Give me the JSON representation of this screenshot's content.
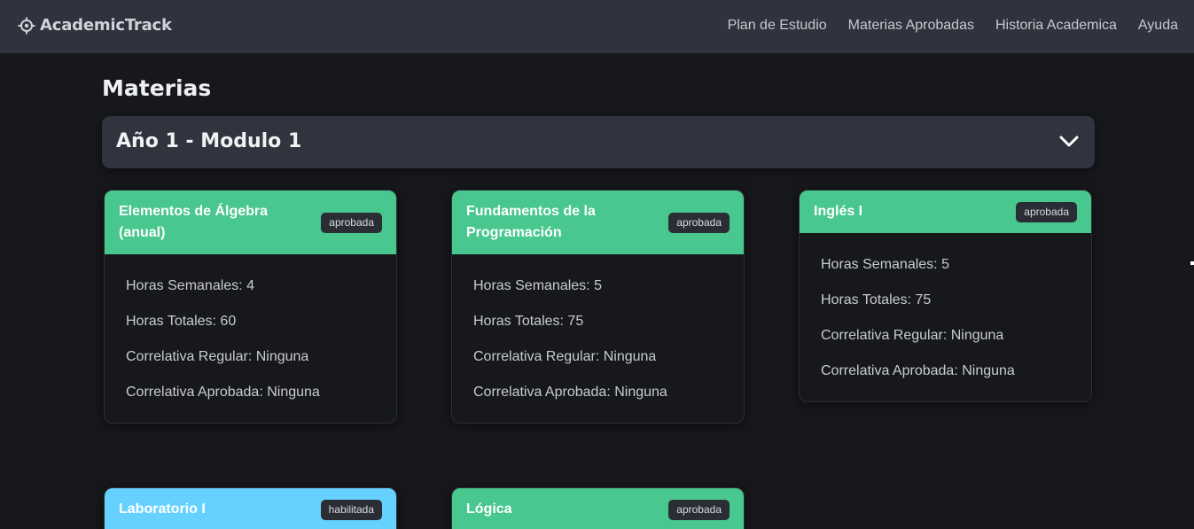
{
  "app": {
    "name": "AcademicTrack",
    "logo_icon": "crosshair-icon"
  },
  "nav": {
    "links": [
      "Plan de Estudio",
      "Materias Aprobadas",
      "Historia Academica",
      "Ayuda"
    ]
  },
  "page": {
    "title": "Materias"
  },
  "accordion": {
    "title": "Año 1 - Modulo 1",
    "icon": "chevron-down-icon"
  },
  "colors": {
    "aprobada": "#48c78e",
    "habilitada": "#66d1ff",
    "navbar": "#2f333d",
    "background": "#17181c"
  },
  "subjects": [
    {
      "name": "Elementos de Álgebra (anual)",
      "status": "aprobada",
      "details": [
        "Horas Semanales: 4",
        "Horas Totales: 60",
        "Correlativa Regular: Ninguna",
        "Correlativa Aprobada: Ninguna"
      ]
    },
    {
      "name": "Fundamentos de la Programación",
      "status": "aprobada",
      "details": [
        "Horas Semanales: 5",
        "Horas Totales: 75",
        "Correlativa Regular: Ninguna",
        "Correlativa Aprobada: Ninguna"
      ]
    },
    {
      "name": "Inglés I",
      "status": "aprobada",
      "details": [
        "Horas Semanales: 5",
        "Horas Totales: 75",
        "Correlativa Regular: Ninguna",
        "Correlativa Aprobada: Ninguna"
      ]
    },
    {
      "name": "Laboratorio I",
      "status": "habilitada",
      "details": []
    },
    {
      "name": "Lógica",
      "status": "aprobada",
      "details": []
    }
  ]
}
